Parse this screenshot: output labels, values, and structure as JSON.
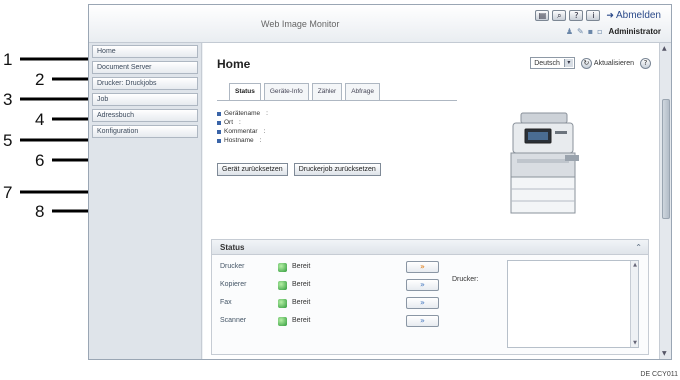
{
  "header": {
    "app_title": "Web Image Monitor",
    "logout_label": "Abmelden",
    "user_name": "Administrator",
    "toolbar_icons": [
      "list-icon",
      "search-icon",
      "help-icon",
      "info-icon"
    ]
  },
  "sidebar": {
    "items": [
      {
        "label": "Home"
      },
      {
        "label": "Document Server"
      },
      {
        "label": "Drucker: Druckjobs"
      },
      {
        "label": "Job"
      },
      {
        "label": "Adressbuch"
      },
      {
        "label": "Konfiguration"
      }
    ]
  },
  "main": {
    "title": "Home",
    "language": "Deutsch",
    "refresh_label": "Aktualisieren",
    "tabs": [
      {
        "label": "Status",
        "active": true
      },
      {
        "label": "Geräte-Info",
        "active": false
      },
      {
        "label": "Zähler",
        "active": false
      },
      {
        "label": "Abfrage",
        "active": false
      }
    ],
    "info": [
      {
        "label": "Gerätename",
        "value": ":"
      },
      {
        "label": "Ort",
        "value": ":"
      },
      {
        "label": "Kommentar",
        "value": ":"
      },
      {
        "label": "Hostname",
        "value": ":"
      }
    ],
    "buttons": {
      "reset_device": "Gerät zurücksetzen",
      "reset_print_job": "Druckerjob zurücksetzen"
    }
  },
  "status": {
    "heading": "Status",
    "devices": [
      {
        "name": "Drucker",
        "state": "Bereit",
        "highlight": true
      },
      {
        "name": "Kopierer",
        "state": "Bereit",
        "highlight": false
      },
      {
        "name": "Fax",
        "state": "Bereit",
        "highlight": false
      },
      {
        "name": "Scanner",
        "state": "Bereit",
        "highlight": false
      }
    ],
    "message_label": "Drucker:"
  },
  "callouts": [
    "1",
    "2",
    "3",
    "4",
    "5",
    "6",
    "7",
    "8"
  ],
  "image_code": "DE CCY011",
  "colors": {
    "accent": "#3a64a8",
    "ready_led": "#2f9a3b",
    "warn_arrow": "#e07a10"
  }
}
